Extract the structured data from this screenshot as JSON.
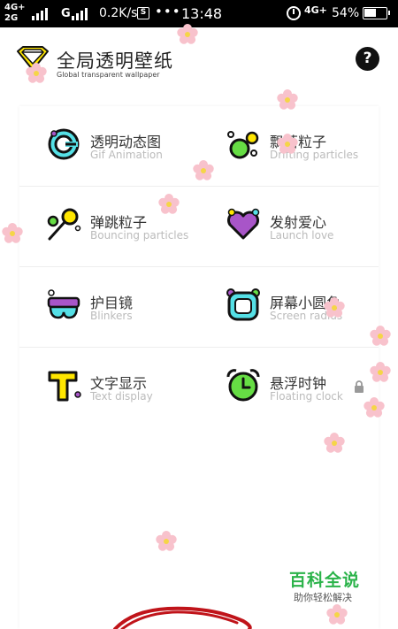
{
  "status_bar": {
    "net_top": "4G+",
    "net_bottom": "2G",
    "net_type2": "G",
    "speed": "0.2K/s",
    "s_badge": "S",
    "more": "•••",
    "time": "13:48",
    "net_right": "4G+",
    "battery_pct": "54%"
  },
  "header": {
    "title": "全局透明壁纸",
    "subtitle": "Global transparent wallpaper",
    "help_icon": "question-icon",
    "help_label": "?"
  },
  "features": [
    {
      "title": "透明动态图",
      "subtitle": "Gif Animation",
      "icon": "gif-icon"
    },
    {
      "title": "飘落粒子",
      "subtitle": "Drifting particles",
      "icon": "drifting-particles-icon"
    },
    {
      "title": "弹跳粒子",
      "subtitle": "Bouncing particles",
      "icon": "bouncing-particles-icon"
    },
    {
      "title": "发射爱心",
      "subtitle": "Launch love",
      "icon": "heart-icon"
    },
    {
      "title": "护目镜",
      "subtitle": "Blinkers",
      "icon": "goggles-icon"
    },
    {
      "title": "屏幕小圆角",
      "subtitle": "Screen radius",
      "icon": "rounded-screen-icon"
    },
    {
      "title": "文字显示",
      "subtitle": "Text display",
      "icon": "text-icon"
    },
    {
      "title": "悬浮时钟",
      "subtitle": "Floating clock",
      "icon": "alarm-clock-icon",
      "locked": true
    }
  ],
  "footer": {
    "brand": "百科全说",
    "brand_sub": "助你轻松解决"
  },
  "colors": {
    "yellow": "#ffe600",
    "cyan": "#55e0e6",
    "green": "#66dd44",
    "purple": "#a855c8",
    "brand_green": "#2bb34a",
    "blossom": "#f8c2cc"
  }
}
